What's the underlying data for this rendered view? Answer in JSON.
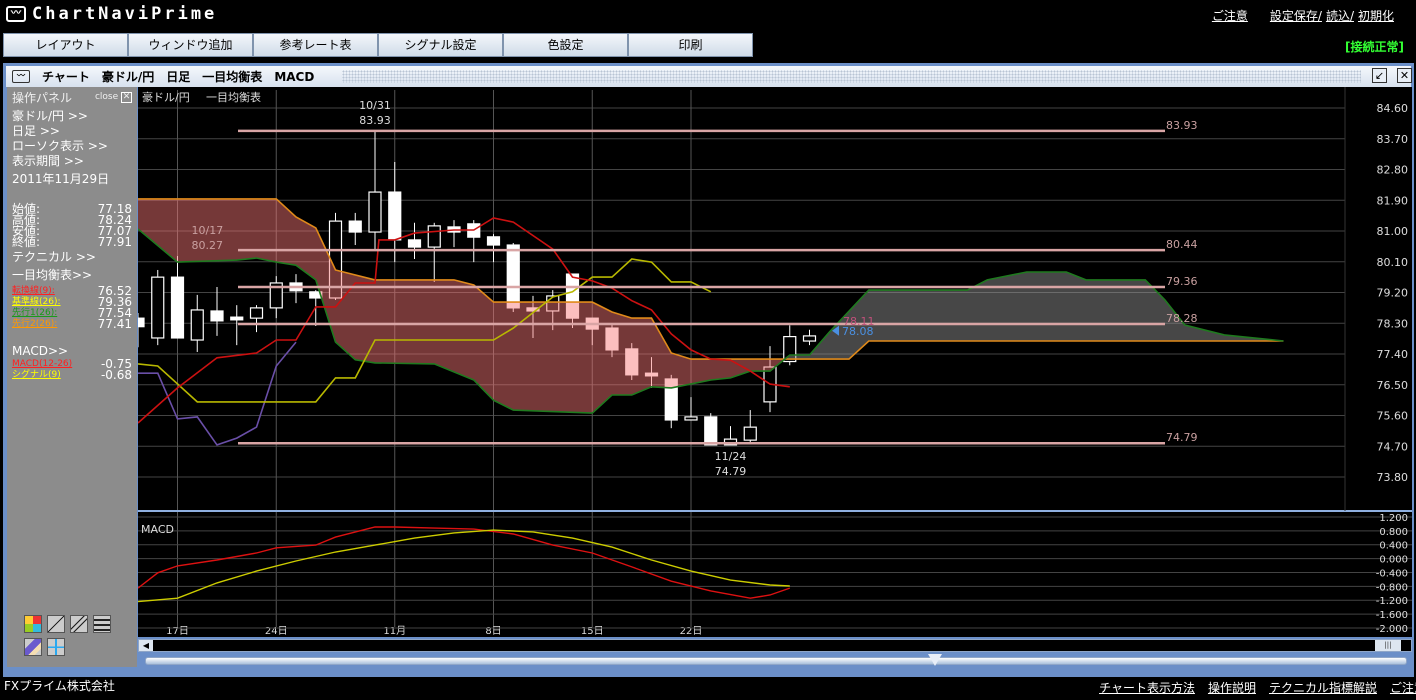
{
  "app": {
    "logo_text": "ChartNaviPrime",
    "status": "[接続正常]"
  },
  "top_links": [
    "ご注意",
    "設定保存/",
    "読込/",
    "初期化"
  ],
  "menu": [
    "レイアウト",
    "ウィンドウ追加",
    "参考レート表",
    "シグナル設定",
    "色設定",
    "印刷"
  ],
  "window": {
    "title_parts": [
      "チャート",
      "豪ドル/円",
      "日足",
      "一目均衡表",
      "MACD"
    ],
    "restore_icon": "restore-icon",
    "close_icon": "close-icon"
  },
  "panel": {
    "title": "操作パネル",
    "close": "close",
    "links": [
      "豪ドル/円 >>",
      "日足 >>",
      "ローソク表示 >>",
      "表示期間 >>"
    ],
    "date": "2011年11月29日",
    "ohlc": [
      {
        "k": "始値:",
        "v": "77.18"
      },
      {
        "k": "高値:",
        "v": "78.24"
      },
      {
        "k": "安値:",
        "v": "77.07"
      },
      {
        "k": "終値:",
        "v": "77.91"
      }
    ],
    "technical": "テクニカル >>",
    "ichimoku_title": "一目均衡表>>",
    "ichimoku": [
      {
        "k": "転換線(9):",
        "v": "76.52",
        "color": "#ff2020"
      },
      {
        "k": "基準線(26):",
        "v": "79.36",
        "color": "#ffff00"
      },
      {
        "k": "先行1(26):",
        "v": "77.54",
        "color": "#1a9a1a"
      },
      {
        "k": "先行2(26):",
        "v": "77.41",
        "color": "#ff9900"
      }
    ],
    "macd_title": "MACD>>",
    "macd": [
      {
        "k": "MACD(12-26)",
        "v": "-0.75",
        "color": "#ff2020"
      },
      {
        "k": "シグナル(9)",
        "v": "-0.68",
        "color": "#ffff00"
      }
    ]
  },
  "footer": {
    "company": "FXプライム株式会社",
    "links": [
      "チャート表示方法",
      "操作説明",
      "テクニカル指標解説",
      "ご注意"
    ]
  },
  "chart_data": {
    "type": "candlestick",
    "main_label": [
      "豪ドル/円",
      "一目均衡表"
    ],
    "y_ticks": [
      "84.60",
      "83.70",
      "82.80",
      "81.90",
      "81.00",
      "80.10",
      "79.20",
      "78.30",
      "77.40",
      "76.50",
      "75.60",
      "74.70",
      "73.80"
    ],
    "x_ticks": [
      {
        "i": 2,
        "label": "17日"
      },
      {
        "i": 7,
        "label": "24日"
      },
      {
        "i": 13,
        "label": "11月"
      },
      {
        "i": 18,
        "label": "8日"
      },
      {
        "i": 23,
        "label": "15日"
      },
      {
        "i": 28,
        "label": "22日"
      }
    ],
    "candles": [
      [
        78.45,
        78.6,
        77.6,
        78.2
      ],
      [
        77.87,
        79.86,
        77.66,
        79.65
      ],
      [
        79.65,
        80.27,
        77.87,
        77.87
      ],
      [
        77.81,
        79.13,
        77.46,
        78.69
      ],
      [
        78.66,
        79.36,
        77.93,
        78.37
      ],
      [
        78.48,
        78.83,
        77.66,
        78.4
      ],
      [
        78.45,
        78.83,
        78.04,
        78.75
      ],
      [
        78.75,
        79.68,
        78.45,
        79.48
      ],
      [
        79.48,
        79.74,
        78.89,
        79.25
      ],
      [
        79.22,
        79.27,
        78.22,
        79.04
      ],
      [
        79.04,
        81.53,
        78.98,
        81.29
      ],
      [
        81.29,
        81.53,
        80.59,
        80.97
      ],
      [
        80.97,
        83.93,
        80.44,
        82.14
      ],
      [
        82.14,
        83.02,
        80.09,
        80.74
      ],
      [
        80.74,
        81.24,
        80.18,
        80.53
      ],
      [
        80.53,
        81.24,
        79.51,
        81.15
      ],
      [
        81.12,
        81.32,
        80.53,
        80.97
      ],
      [
        81.21,
        81.32,
        80.09,
        80.82
      ],
      [
        80.83,
        80.91,
        80.09,
        80.59
      ],
      [
        80.59,
        80.65,
        78.63,
        78.75
      ],
      [
        78.75,
        79.1,
        77.87,
        78.66
      ],
      [
        78.66,
        79.27,
        78.1,
        79.1
      ],
      [
        79.74,
        79.74,
        78.16,
        78.45
      ],
      [
        78.45,
        78.45,
        77.66,
        78.13
      ],
      [
        78.16,
        78.28,
        77.31,
        77.52
      ],
      [
        77.55,
        77.72,
        76.64,
        76.79
      ],
      [
        76.84,
        77.31,
        76.41,
        76.76
      ],
      [
        76.67,
        76.79,
        75.23,
        75.47
      ],
      [
        75.47,
        76.14,
        75.47,
        75.56
      ],
      [
        75.56,
        75.67,
        74.8,
        74.74
      ],
      [
        74.74,
        75.29,
        74.79,
        74.91
      ],
      [
        74.88,
        75.76,
        74.8,
        75.26
      ],
      [
        76.0,
        77.63,
        75.7,
        77.02
      ],
      [
        77.18,
        78.24,
        77.07,
        77.91
      ],
      [
        77.78,
        78.11,
        77.66,
        77.93
      ]
    ],
    "tenkan": [
      [
        0,
        75.38
      ],
      [
        2,
        76.41
      ],
      [
        4,
        77.29
      ],
      [
        6,
        77.43
      ],
      [
        7,
        77.81
      ],
      [
        8,
        77.81
      ],
      [
        9,
        78.78
      ],
      [
        10,
        78.78
      ],
      [
        11,
        79.48
      ],
      [
        12,
        79.48
      ],
      [
        12.2,
        80.74
      ],
      [
        13,
        80.74
      ],
      [
        14,
        80.94
      ],
      [
        16,
        81.03
      ],
      [
        17,
        81.03
      ],
      [
        18,
        81.38
      ],
      [
        19,
        81.26
      ],
      [
        21,
        80.47
      ],
      [
        22,
        79.65
      ],
      [
        23,
        79.54
      ],
      [
        24,
        79.33
      ],
      [
        25,
        78.96
      ],
      [
        26,
        78.69
      ],
      [
        27,
        77.99
      ],
      [
        28,
        77.52
      ],
      [
        29,
        77.25
      ],
      [
        30,
        77.22
      ],
      [
        31,
        76.9
      ],
      [
        32,
        76.52
      ],
      [
        33,
        76.44
      ]
    ],
    "kijun": [
      [
        0,
        77.11
      ],
      [
        1,
        77.05
      ],
      [
        3,
        76.0
      ],
      [
        9,
        76.0
      ],
      [
        10,
        76.7
      ],
      [
        11,
        76.7
      ],
      [
        12,
        77.81
      ],
      [
        18,
        77.81
      ],
      [
        19,
        78.16
      ],
      [
        21,
        79.07
      ],
      [
        22,
        79.22
      ],
      [
        23,
        79.65
      ],
      [
        24,
        79.65
      ],
      [
        25,
        80.18
      ],
      [
        26,
        80.09
      ],
      [
        27,
        79.51
      ],
      [
        28,
        79.51
      ],
      [
        29,
        79.22
      ]
    ],
    "chikou": [
      [
        0,
        76.84
      ],
      [
        1,
        76.84
      ],
      [
        2,
        75.5
      ],
      [
        3,
        75.56
      ],
      [
        4,
        74.74
      ],
      [
        5,
        74.94
      ],
      [
        6,
        75.26
      ],
      [
        7,
        77.05
      ],
      [
        8,
        77.75
      ]
    ],
    "senkou1": [
      [
        0,
        81.06
      ],
      [
        2,
        80.09
      ],
      [
        5,
        80.15
      ],
      [
        6,
        80.21
      ],
      [
        7,
        80.09
      ],
      [
        8,
        80.0
      ],
      [
        9,
        79.57
      ],
      [
        10,
        77.75
      ],
      [
        11,
        77.23
      ],
      [
        12,
        77.14
      ],
      [
        15,
        77.11
      ],
      [
        17,
        76.64
      ],
      [
        18,
        76.05
      ],
      [
        19,
        75.76
      ],
      [
        23,
        75.67
      ],
      [
        24,
        76.2
      ],
      [
        25,
        76.2
      ],
      [
        26,
        76.44
      ],
      [
        27,
        76.41
      ],
      [
        29,
        76.64
      ],
      [
        30,
        76.7
      ],
      [
        31,
        76.9
      ],
      [
        32,
        76.9
      ],
      [
        33,
        77.37
      ],
      [
        34,
        77.37
      ],
      [
        35,
        78.04
      ],
      [
        37,
        79.27
      ],
      [
        42,
        79.27
      ],
      [
        43,
        79.57
      ],
      [
        45,
        79.8
      ],
      [
        47,
        79.8
      ],
      [
        48,
        79.57
      ],
      [
        51,
        79.57
      ],
      [
        52,
        78.98
      ],
      [
        53,
        78.25
      ],
      [
        55,
        77.96
      ],
      [
        58,
        77.78
      ]
    ],
    "senkou2": [
      [
        0,
        81.94
      ],
      [
        7,
        81.94
      ],
      [
        8,
        81.41
      ],
      [
        9,
        81.09
      ],
      [
        10,
        79.86
      ],
      [
        12,
        79.57
      ],
      [
        16,
        79.57
      ],
      [
        17,
        79.42
      ],
      [
        18,
        78.92
      ],
      [
        23,
        78.92
      ],
      [
        24,
        78.63
      ],
      [
        25,
        78.45
      ],
      [
        26,
        78.45
      ],
      [
        27,
        77.43
      ],
      [
        28,
        77.25
      ],
      [
        36,
        77.25
      ],
      [
        37,
        77.78
      ],
      [
        58,
        77.78
      ]
    ],
    "hlines": [
      {
        "v": 83.93,
        "label": "83.93"
      },
      {
        "v": 80.44,
        "label": "80.44"
      },
      {
        "v": 79.36,
        "label": "79.36"
      },
      {
        "v": 78.28,
        "label": "78.28"
      },
      {
        "v": 74.79,
        "label": "74.79"
      }
    ],
    "annotations": [
      {
        "i": 12,
        "date": "10/31",
        "value": "83.93",
        "pos": "above"
      },
      {
        "i": 2,
        "date": "10/17",
        "value": "80.27",
        "pos": "above"
      },
      {
        "i": 30,
        "date": "11/24",
        "value": "74.79",
        "pos": "below"
      }
    ],
    "marker_high": {
      "v": 78.11,
      "label": "78.11"
    },
    "current_price": {
      "v": 78.08,
      "label": "78.08"
    },
    "macd_panel": {
      "label": "MACD",
      "y_ticks": [
        "1.200",
        "0.800",
        "0.400",
        "0.000",
        "-0.400",
        "-0.800",
        "-1.200",
        "-1.600",
        "-2.000"
      ],
      "macd": [
        [
          0,
          -0.85
        ],
        [
          1,
          -0.41
        ],
        [
          2,
          -0.21
        ],
        [
          4,
          -0.04
        ],
        [
          6,
          0.16
        ],
        [
          7,
          0.31
        ],
        [
          9,
          0.39
        ],
        [
          10,
          0.62
        ],
        [
          12,
          0.91
        ],
        [
          13,
          0.91
        ],
        [
          15,
          0.88
        ],
        [
          17,
          0.85
        ],
        [
          19,
          0.71
        ],
        [
          21,
          0.39
        ],
        [
          23,
          0.16
        ],
        [
          25,
          -0.24
        ],
        [
          27,
          -0.65
        ],
        [
          29,
          -0.93
        ],
        [
          31,
          -1.14
        ],
        [
          32,
          -1.05
        ],
        [
          33,
          -0.85
        ]
      ],
      "signal": [
        [
          0,
          -1.24
        ],
        [
          2,
          -1.14
        ],
        [
          4,
          -0.7
        ],
        [
          6,
          -0.36
        ],
        [
          8,
          -0.07
        ],
        [
          10,
          0.19
        ],
        [
          12,
          0.39
        ],
        [
          14,
          0.59
        ],
        [
          16,
          0.74
        ],
        [
          18,
          0.82
        ],
        [
          20,
          0.77
        ],
        [
          22,
          0.59
        ],
        [
          24,
          0.33
        ],
        [
          26,
          -0.04
        ],
        [
          28,
          -0.36
        ],
        [
          30,
          -0.62
        ],
        [
          32,
          -0.76
        ],
        [
          33,
          -0.79
        ]
      ]
    },
    "colors": {
      "tenkan": "#cc1111",
      "kijun": "#b8b800",
      "chikou": "#6a4fa8",
      "senkou1": "#1f7a1f",
      "senkou2": "#e08a1a",
      "cloud_bear": "#f87878",
      "cloud_bull": "#969696",
      "hline": "#d9a5a5",
      "macd": "#dd1111",
      "signal": "#cccc00"
    }
  }
}
